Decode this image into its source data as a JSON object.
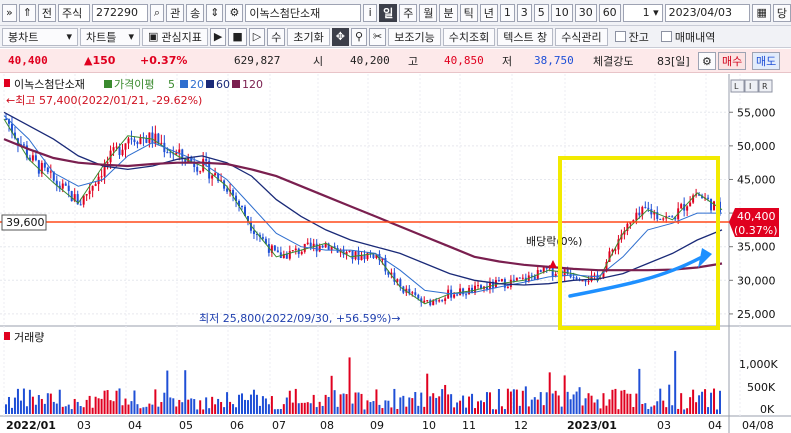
{
  "toolbar1": {
    "code": "272290",
    "market": "주식",
    "name": "이녹스첨단소재",
    "period_buttons": [
      "일",
      "주",
      "월",
      "분",
      "틱",
      "년"
    ],
    "minute_buttons": [
      "1",
      "3",
      "5",
      "10",
      "30",
      "60"
    ],
    "active_period": "일",
    "count_value": "1",
    "date": "2023/04/03",
    "small_labels": [
      "전",
      "관",
      "송",
      "i",
      "당"
    ]
  },
  "toolbar2": {
    "buttons": [
      "봉차트",
      "차트틀",
      "관심지표",
      "수",
      "초기화",
      "보조기능",
      "수치조회",
      "텍스트 창",
      "수식관리"
    ],
    "checkboxes": [
      "잔고",
      "매매내역"
    ]
  },
  "quote": {
    "price": "40,400",
    "change": "▲150",
    "change_pct": "+0.37%",
    "volume": "629,827",
    "open_label": "시",
    "open": "40,200",
    "high_label": "고",
    "high": "40,850",
    "low_label": "저",
    "low": "38,750",
    "strength_label": "체결강도",
    "strength": "83[일]",
    "buy_label": "매수",
    "sell_label": "매도"
  },
  "legend": {
    "name": "이녹스첨단소재",
    "ma_label": "가격이평",
    "ma_periods": [
      "5",
      "20",
      "60",
      "120"
    ],
    "ma_colors": [
      "#3a8a2e",
      "#2f6fcf",
      "#1a2a78",
      "#7a1f4f"
    ]
  },
  "annotations": {
    "high": "←최고 57,400(2022/01/21, -29.62%)",
    "low": "최저 25,800(2022/09/30, +56.59%)→",
    "dividend": "배당락(0%)",
    "price_tag": "40,400",
    "price_tag_pct": "(0.37%)",
    "left_tag": "39,600"
  },
  "volume_panel": {
    "title": "거래량",
    "ticks": [
      "1,000K",
      "500K",
      "0K"
    ]
  },
  "colors": {
    "up": "#e0001f",
    "down": "#1f4fd6",
    "highlight": "#f2ea00",
    "arrow": "#1e90ff",
    "hline": "#ff4a1a"
  },
  "chart_data": {
    "type": "candlestick",
    "symbol": "이녹스첨단소재",
    "y_ticks": [
      25000,
      30000,
      35000,
      40000,
      45000,
      50000,
      55000
    ],
    "ylim": [
      23500,
      59500
    ],
    "x_labels": [
      "2022/01",
      "03",
      "04",
      "05",
      "06",
      "07",
      "08",
      "09",
      "10",
      "11",
      "12",
      "2023/01",
      "03",
      "04",
      "04/08"
    ],
    "series": [
      {
        "name": "5",
        "values": [
          54000,
          48000,
          44500,
          41500,
          47000,
          51500,
          51000,
          48500,
          47000,
          44000,
          38000,
          33500,
          34500,
          35500,
          33500,
          34000,
          29000,
          26500,
          28000,
          28500,
          29500,
          30000,
          31500,
          31000,
          30000,
          37000,
          40500,
          39000,
          43000,
          40500
        ]
      },
      {
        "name": "20",
        "values": [
          54500,
          51000,
          46000,
          44000,
          45000,
          48500,
          50500,
          49000,
          47500,
          45000,
          41000,
          37000,
          35000,
          34500,
          34500,
          34000,
          31500,
          28500,
          28000,
          28200,
          29000,
          29700,
          30500,
          30800,
          30500,
          33500,
          37500,
          38500,
          40000,
          40000
        ]
      },
      {
        "name": "60",
        "values": [
          55000,
          53000,
          51000,
          48500,
          47000,
          46500,
          47000,
          48000,
          48500,
          47500,
          45500,
          42000,
          39500,
          37500,
          36000,
          35000,
          34000,
          32500,
          31000,
          30000,
          29500,
          29300,
          29500,
          30000,
          30200,
          31000,
          32500,
          34000,
          36000,
          37500
        ]
      },
      {
        "name": "120",
        "values": [
          51000,
          49500,
          48200,
          47500,
          47200,
          47000,
          47300,
          47500,
          47500,
          47300,
          46500,
          45500,
          44000,
          42500,
          41000,
          39500,
          38000,
          36500,
          35000,
          33500,
          32800,
          32300,
          32000,
          31700,
          31500,
          31500,
          31500,
          31600,
          31900,
          32500
        ]
      }
    ],
    "last_price": 40400,
    "high_point": {
      "value": 57400,
      "date": "2022/01/21"
    },
    "low_point": {
      "value": 25800,
      "date": "2022/09/30"
    },
    "volume": {
      "ylim": [
        0,
        1250000
      ],
      "ticks": [
        0,
        500000,
        1000000
      ]
    }
  }
}
